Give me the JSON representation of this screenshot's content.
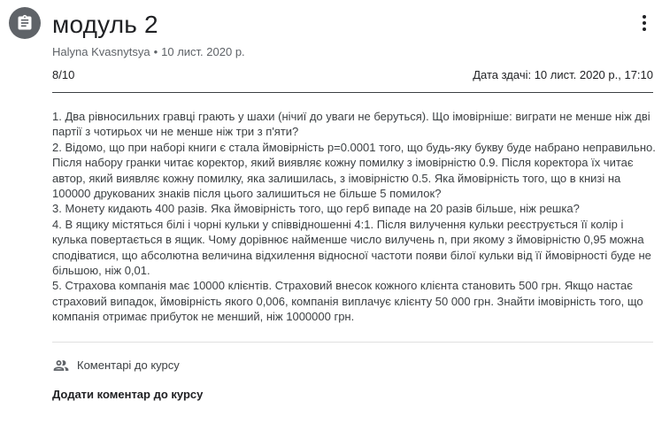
{
  "header": {
    "icon": "assignment-icon",
    "title": "модуль 2",
    "more_icon": "more-vert-icon"
  },
  "meta": {
    "author": "Halyna Kvasnytsya",
    "separator": "•",
    "date": "10 лист. 2020 р."
  },
  "points": "8/10",
  "due": "Дата здачі: 10 лист. 2020 р., 17:10",
  "body": {
    "lines": [
      "1. Два рівносильних гравці грають у шахи (нічиї до уваги не беруться). Що імовірніше: виграти не менше ніж дві партії з чотирьох чи не менше ніж три з п'яти?",
      "2. Відомо, що при наборі книги є стала ймовірність p=0.0001 того, що будь-яку букву буде набрано неправильно. Після набору гранки читає коректор, який виявляє кожну помилку з імовірністю 0.9. Після коректора їх читає автор, який виявляє кожну помилку, яка залишилась, з імовірністю 0.5. Яка ймовірність того, що в книзі на 100000 друкованих знаків після цього залишиться не більше 5 помилок?",
      "3. Монету кидають 400 разів. Яка ймовірність того, що герб випаде на 20 разів більше, ніж решка?",
      "4. В ящику містяться білі і чорні кульки у співвідношенні 4:1. Після вилучення кульки реєструється її колір і кулька повертається в ящик. Чому дорівнює найменше число вилучень n, при якому з ймовірністю 0,95 можна сподіватися, що абсолютна величина відхилення відносної частоти появи білої кульки від її ймовірності буде не більшою, ніж 0,01.",
      "5. Страхова компанія має 10000 клієнтів. Страховий внесок кожного клієнта становить 500 грн. Якщо настає страховий випадок, ймовірність якого 0,006, компанія виплачує клієнту 50 000 грн. Знайти імовірність того, що компанія отримає прибуток не менший, ніж 1000000 грн."
    ]
  },
  "comments": {
    "icon": "people-icon",
    "label": "Коментарі до курсу",
    "add_label": "Додати коментар до курсу"
  }
}
